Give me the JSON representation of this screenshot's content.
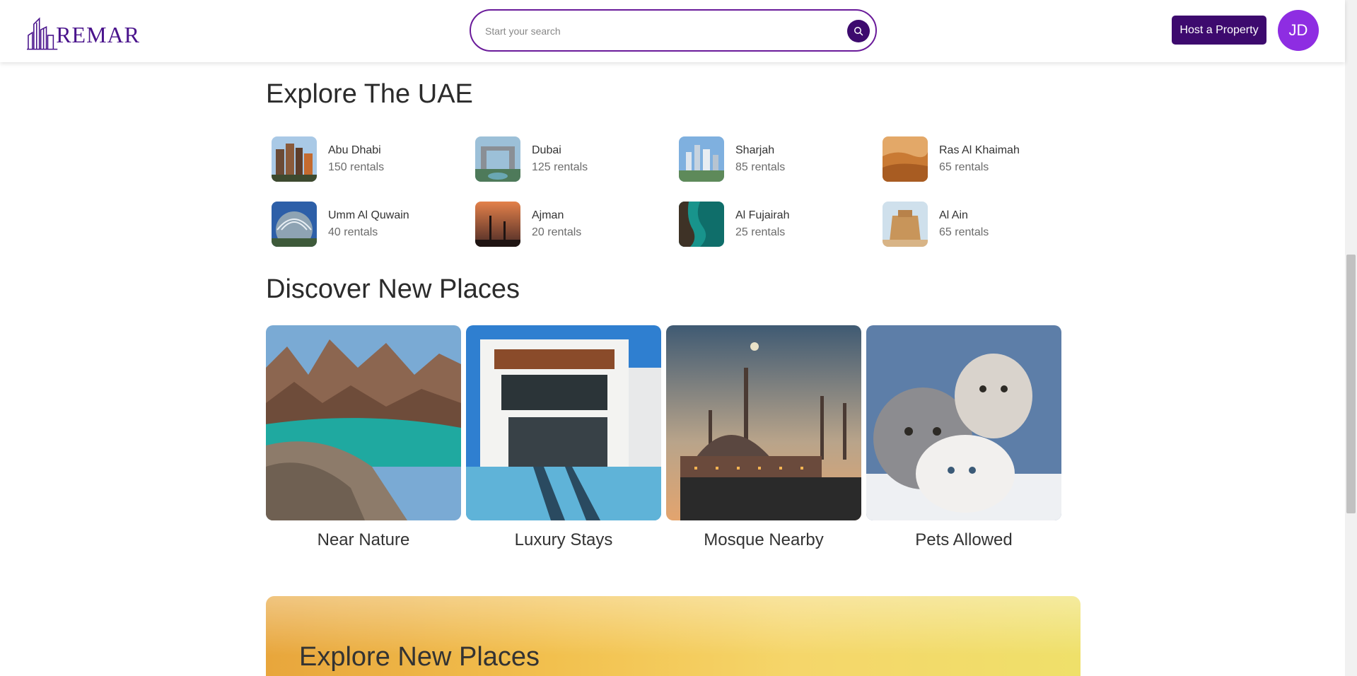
{
  "header": {
    "logo": "REMAR",
    "search": {
      "placeholder": "Start your search"
    },
    "host_label": "Host a Property",
    "avatar_initials": "JD"
  },
  "explore_uae": {
    "title": "Explore The UAE",
    "emirates": [
      {
        "name": "Abu Dhabi",
        "count": "150 rentals"
      },
      {
        "name": "Dubai",
        "count": "125 rentals"
      },
      {
        "name": "Sharjah",
        "count": "85 rentals"
      },
      {
        "name": "Ras Al Khaimah",
        "count": "65 rentals"
      },
      {
        "name": "Umm Al Quwain",
        "count": "40 rentals"
      },
      {
        "name": "Ajman",
        "count": "20 rentals"
      },
      {
        "name": "Al Fujairah",
        "count": "25 rentals"
      },
      {
        "name": "Al Ain",
        "count": "65 rentals"
      }
    ]
  },
  "discover": {
    "title": "Discover New Places",
    "cards": [
      {
        "label": "Near Nature"
      },
      {
        "label": "Luxury Stays"
      },
      {
        "label": "Mosque Nearby"
      },
      {
        "label": "Pets Allowed"
      }
    ]
  },
  "banner": {
    "title": "Explore New Places"
  },
  "colors": {
    "brand": "#3d0a6e",
    "avatar": "#8e2de2",
    "search_border": "#6a1b9a"
  }
}
